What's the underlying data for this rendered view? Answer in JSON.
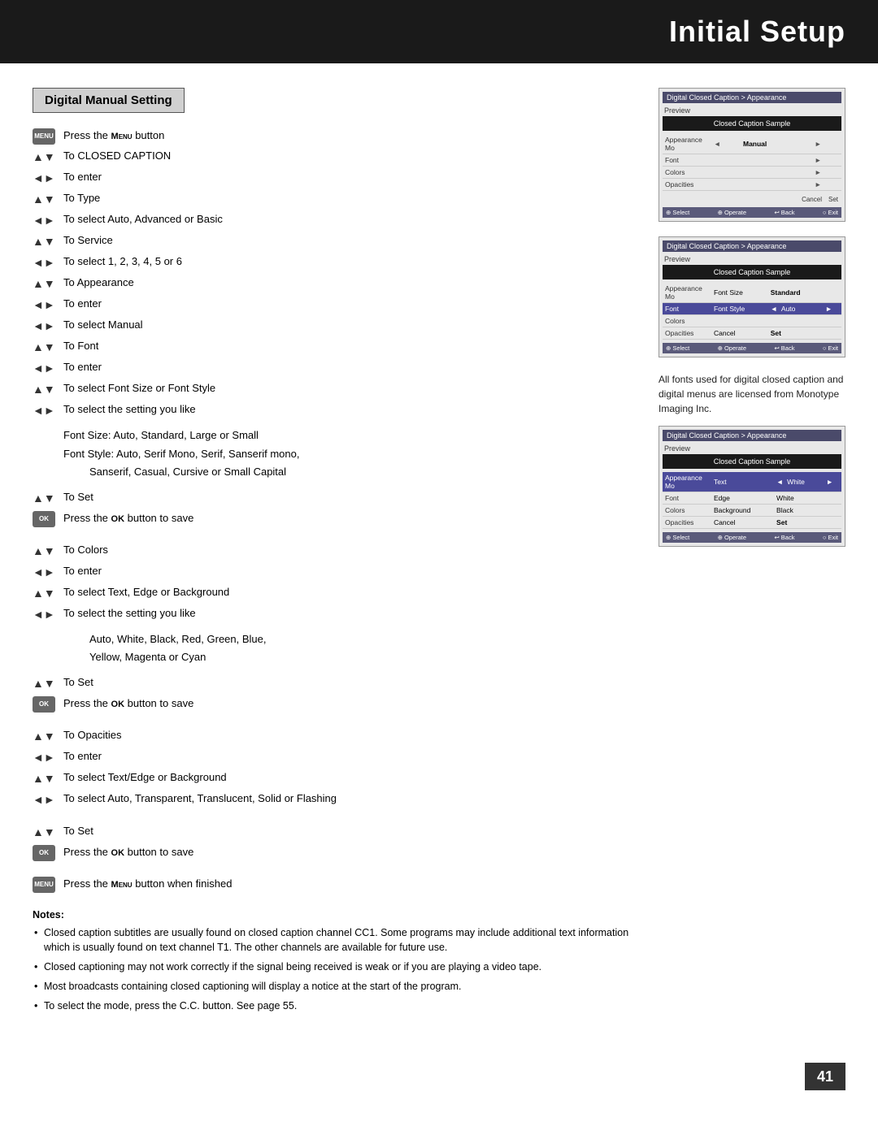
{
  "page": {
    "title": "Initial Setup",
    "page_number": "41"
  },
  "section": {
    "title": "Digital Manual Setting"
  },
  "instructions": [
    {
      "icon": "menu-btn",
      "text": "Press the MENU button",
      "bold_word": "MENU"
    },
    {
      "icon": "arrow-ud",
      "text": "To CLOSED CAPTION"
    },
    {
      "icon": "arrow-lr",
      "text": "To enter"
    },
    {
      "icon": "arrow-ud",
      "text": "To Type"
    },
    {
      "icon": "arrow-lr",
      "text": "To select Auto, Advanced or Basic"
    },
    {
      "icon": "arrow-ud",
      "text": "To Service"
    },
    {
      "icon": "arrow-lr",
      "text": "To select 1, 2, 3, 4, 5 or 6"
    },
    {
      "icon": "arrow-ud",
      "text": "To Appearance"
    },
    {
      "icon": "arrow-lr",
      "text": "To enter"
    },
    {
      "icon": "arrow-lr",
      "text": "To select Manual"
    },
    {
      "icon": "arrow-ud",
      "text": "To Font"
    },
    {
      "icon": "arrow-lr",
      "text": "To enter"
    },
    {
      "icon": "arrow-ud",
      "text": "To select Font Size or Font Style"
    },
    {
      "icon": "arrow-lr",
      "text": "To select the setting you like"
    }
  ],
  "font_info": [
    "Font Size: Auto, Standard, Large or Small",
    "Font Style: Auto, Serif Mono, Serif, Sanserif mono,",
    "    Sanserif, Casual, Cursive or Small Capital"
  ],
  "instructions2": [
    {
      "icon": "arrow-ud",
      "text": "To Set"
    },
    {
      "icon": "ok-btn",
      "text": "Press the OK button to save",
      "bold_word": "OK"
    }
  ],
  "instructions3": [
    {
      "icon": "arrow-ud",
      "text": "To Colors"
    },
    {
      "icon": "arrow-lr",
      "text": "To enter"
    },
    {
      "icon": "arrow-ud",
      "text": "To select Text, Edge or Background"
    },
    {
      "icon": "arrow-lr",
      "text": "To select the setting you like"
    }
  ],
  "color_list": "Auto, White, Black, Red, Green, Blue, Yellow, Magenta or Cyan",
  "instructions4": [
    {
      "icon": "arrow-ud",
      "text": "To Set"
    },
    {
      "icon": "ok-btn",
      "text": "Press the OK button to save",
      "bold_word": "OK"
    }
  ],
  "instructions5": [
    {
      "icon": "arrow-ud",
      "text": "To Opacities"
    },
    {
      "icon": "arrow-lr",
      "text": "To enter"
    },
    {
      "icon": "arrow-ud",
      "text": "To select Text/Edge or Background"
    },
    {
      "icon": "arrow-lr",
      "text": "To select Auto, Transparent, Translucent, Solid or Flashing"
    }
  ],
  "instructions6": [
    {
      "icon": "arrow-ud",
      "text": "To Set"
    },
    {
      "icon": "ok-btn",
      "text": "Press the OK button to save",
      "bold_word": "OK"
    },
    {
      "icon": "menu-btn",
      "text": "Press the MENU button when finished",
      "bold_word": "MENU"
    }
  ],
  "notes": {
    "title": "Notes:",
    "items": [
      "Closed caption subtitles are usually found on closed caption channel CC1. Some programs may include additional text information which is usually found on text channel T1. The other channels are available for future use.",
      "Closed captioning may not work correctly if the signal being received is weak or if you are playing a video tape.",
      "Most broadcasts containing closed captioning will display a notice at the start of the program.",
      "To select the mode, press the C.C. button. See page 55."
    ]
  },
  "side_note": "All fonts used for digital closed caption and digital menus are licensed from Monotype Imaging Inc.",
  "ui_screens": [
    {
      "title": "Digital Closed Caption > Appearance",
      "preview_label": "Preview",
      "preview_text": "Closed Caption Sample",
      "rows": [
        {
          "label": "Appearance Mo",
          "key": "◄",
          "value": "Manual",
          "arrow": "►"
        },
        {
          "label": "Font",
          "key": "",
          "value": "",
          "arrow": "►"
        },
        {
          "label": "Colors",
          "key": "",
          "value": "",
          "arrow": "►"
        },
        {
          "label": "Opacities",
          "key": "",
          "value": "",
          "arrow": "►"
        }
      ],
      "cancel_set": [
        "Cancel",
        "Set"
      ],
      "buttons": [
        "⊕ Select",
        "⊕ Operate",
        "↩ Back",
        "○ Exit"
      ]
    },
    {
      "title": "Digital Closed Caption > Appearance",
      "preview_label": "Preview",
      "preview_text": "Closed Caption Sample",
      "rows": [
        {
          "label": "Appearance Mo",
          "key": "Font Size",
          "value": "Standard",
          "arrow": ""
        },
        {
          "label": "Font",
          "key": "Font Style",
          "value": "◄  Auto",
          "arrow": "►",
          "highlight": true
        },
        {
          "label": "Colors",
          "key": "",
          "value": "",
          "arrow": ""
        },
        {
          "label": "Opacities",
          "key": "Cancel",
          "value": "Set",
          "arrow": ""
        }
      ],
      "cancel_set": [],
      "buttons": [
        "⊕ Select",
        "⊕ Operate",
        "↩ Back",
        "○ Exit"
      ]
    },
    {
      "title": "Digital Closed Caption > Appearance",
      "preview_label": "Preview",
      "preview_text": "Closed Caption Sample",
      "rows": [
        {
          "label": "Appearance Mo",
          "key": "Text",
          "value": "◄  White",
          "arrow": "►",
          "highlight": true
        },
        {
          "label": "Font",
          "key": "Edge",
          "value": "White",
          "arrow": ""
        },
        {
          "label": "Colors",
          "key": "Background",
          "value": "Black",
          "arrow": ""
        },
        {
          "label": "Opacities",
          "key": "Cancel",
          "value": "Set",
          "arrow": ""
        }
      ],
      "cancel_set": [],
      "buttons": [
        "⊕ Select",
        "⊕ Operate",
        "↩ Back",
        "○ Exit"
      ]
    }
  ]
}
